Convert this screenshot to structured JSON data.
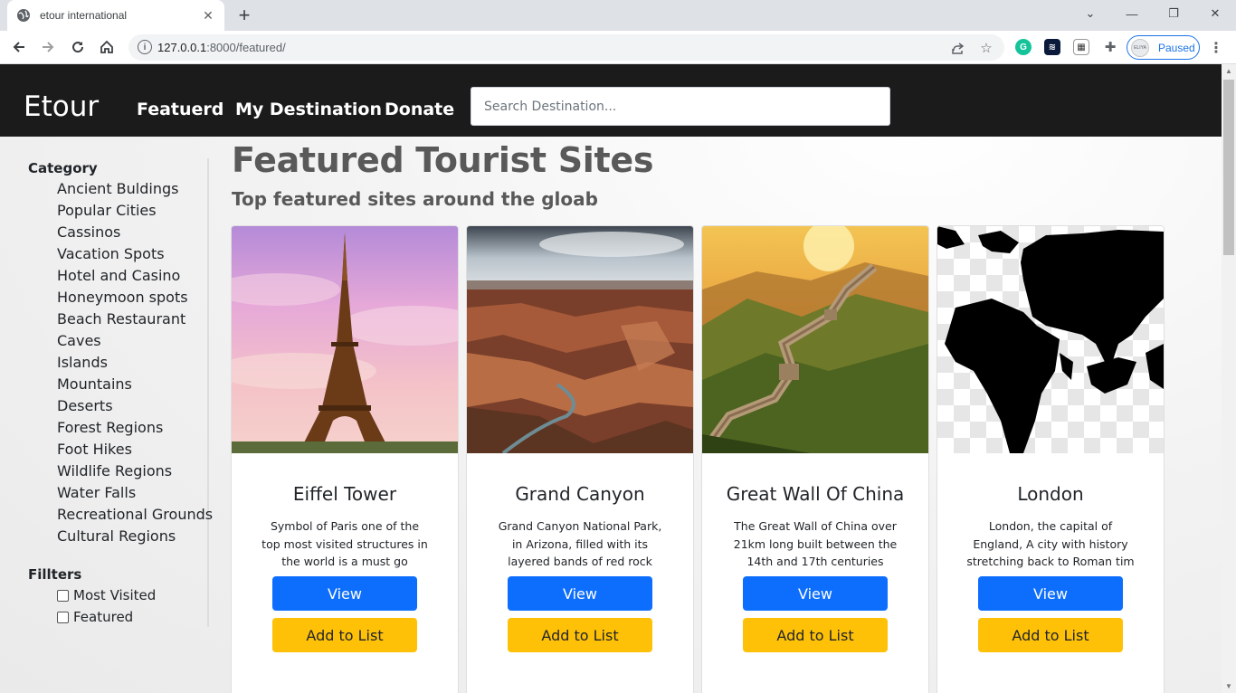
{
  "browser": {
    "tab_title": "etour international",
    "url_host": "127.0.0.1",
    "url_rest": ":8000/featured/",
    "profile_label": "Paused",
    "profile_avatar_text": "ELIYA"
  },
  "nav": {
    "brand": "Etour",
    "links": [
      "Featuerd",
      "My Destination",
      "Donate"
    ],
    "search_placeholder": "Search Destination..."
  },
  "sidebar": {
    "category_heading": "Category",
    "categories": [
      "Ancient Buldings",
      "Popular Cities",
      "Cassinos",
      "Vacation Spots",
      "Hotel and Casino",
      "Honeymoon spots",
      "Beach Restaurant",
      "Caves",
      "Islands",
      "Mountains",
      "Deserts",
      "Forest Regions",
      "Foot Hikes",
      "Wildlife Regions",
      "Water Falls",
      "Recreational Grounds",
      "Cultural Regions"
    ],
    "filters_heading": "Fillters",
    "filters": [
      "Most Visited",
      "Featured"
    ]
  },
  "main": {
    "title": "Featured Tourist Sites",
    "subtitle": "Top featured sites around the gloab"
  },
  "cards": [
    {
      "title": "Eiffel Tower",
      "desc": "Symbol of Paris one of the top most visited structures in the world is a must go",
      "view": "View",
      "add": "Add to List"
    },
    {
      "title": "Grand Canyon",
      "desc": "Grand Canyon National Park, in Arizona, filled with its layered bands of red rock",
      "view": "View",
      "add": "Add to List"
    },
    {
      "title": "Great Wall Of China",
      "desc": "The Great Wall of China over 21km long built between the 14th and 17th centuries",
      "view": "View",
      "add": "Add to List"
    },
    {
      "title": "London",
      "desc": "London, the capital of England, A city with history stretching back to Roman tim",
      "view": "View",
      "add": "Add to List"
    }
  ],
  "colors": {
    "navbar": "#1c1b1b",
    "primary": "#0d6efd",
    "warning": "#ffc107",
    "heading": "#595959"
  }
}
